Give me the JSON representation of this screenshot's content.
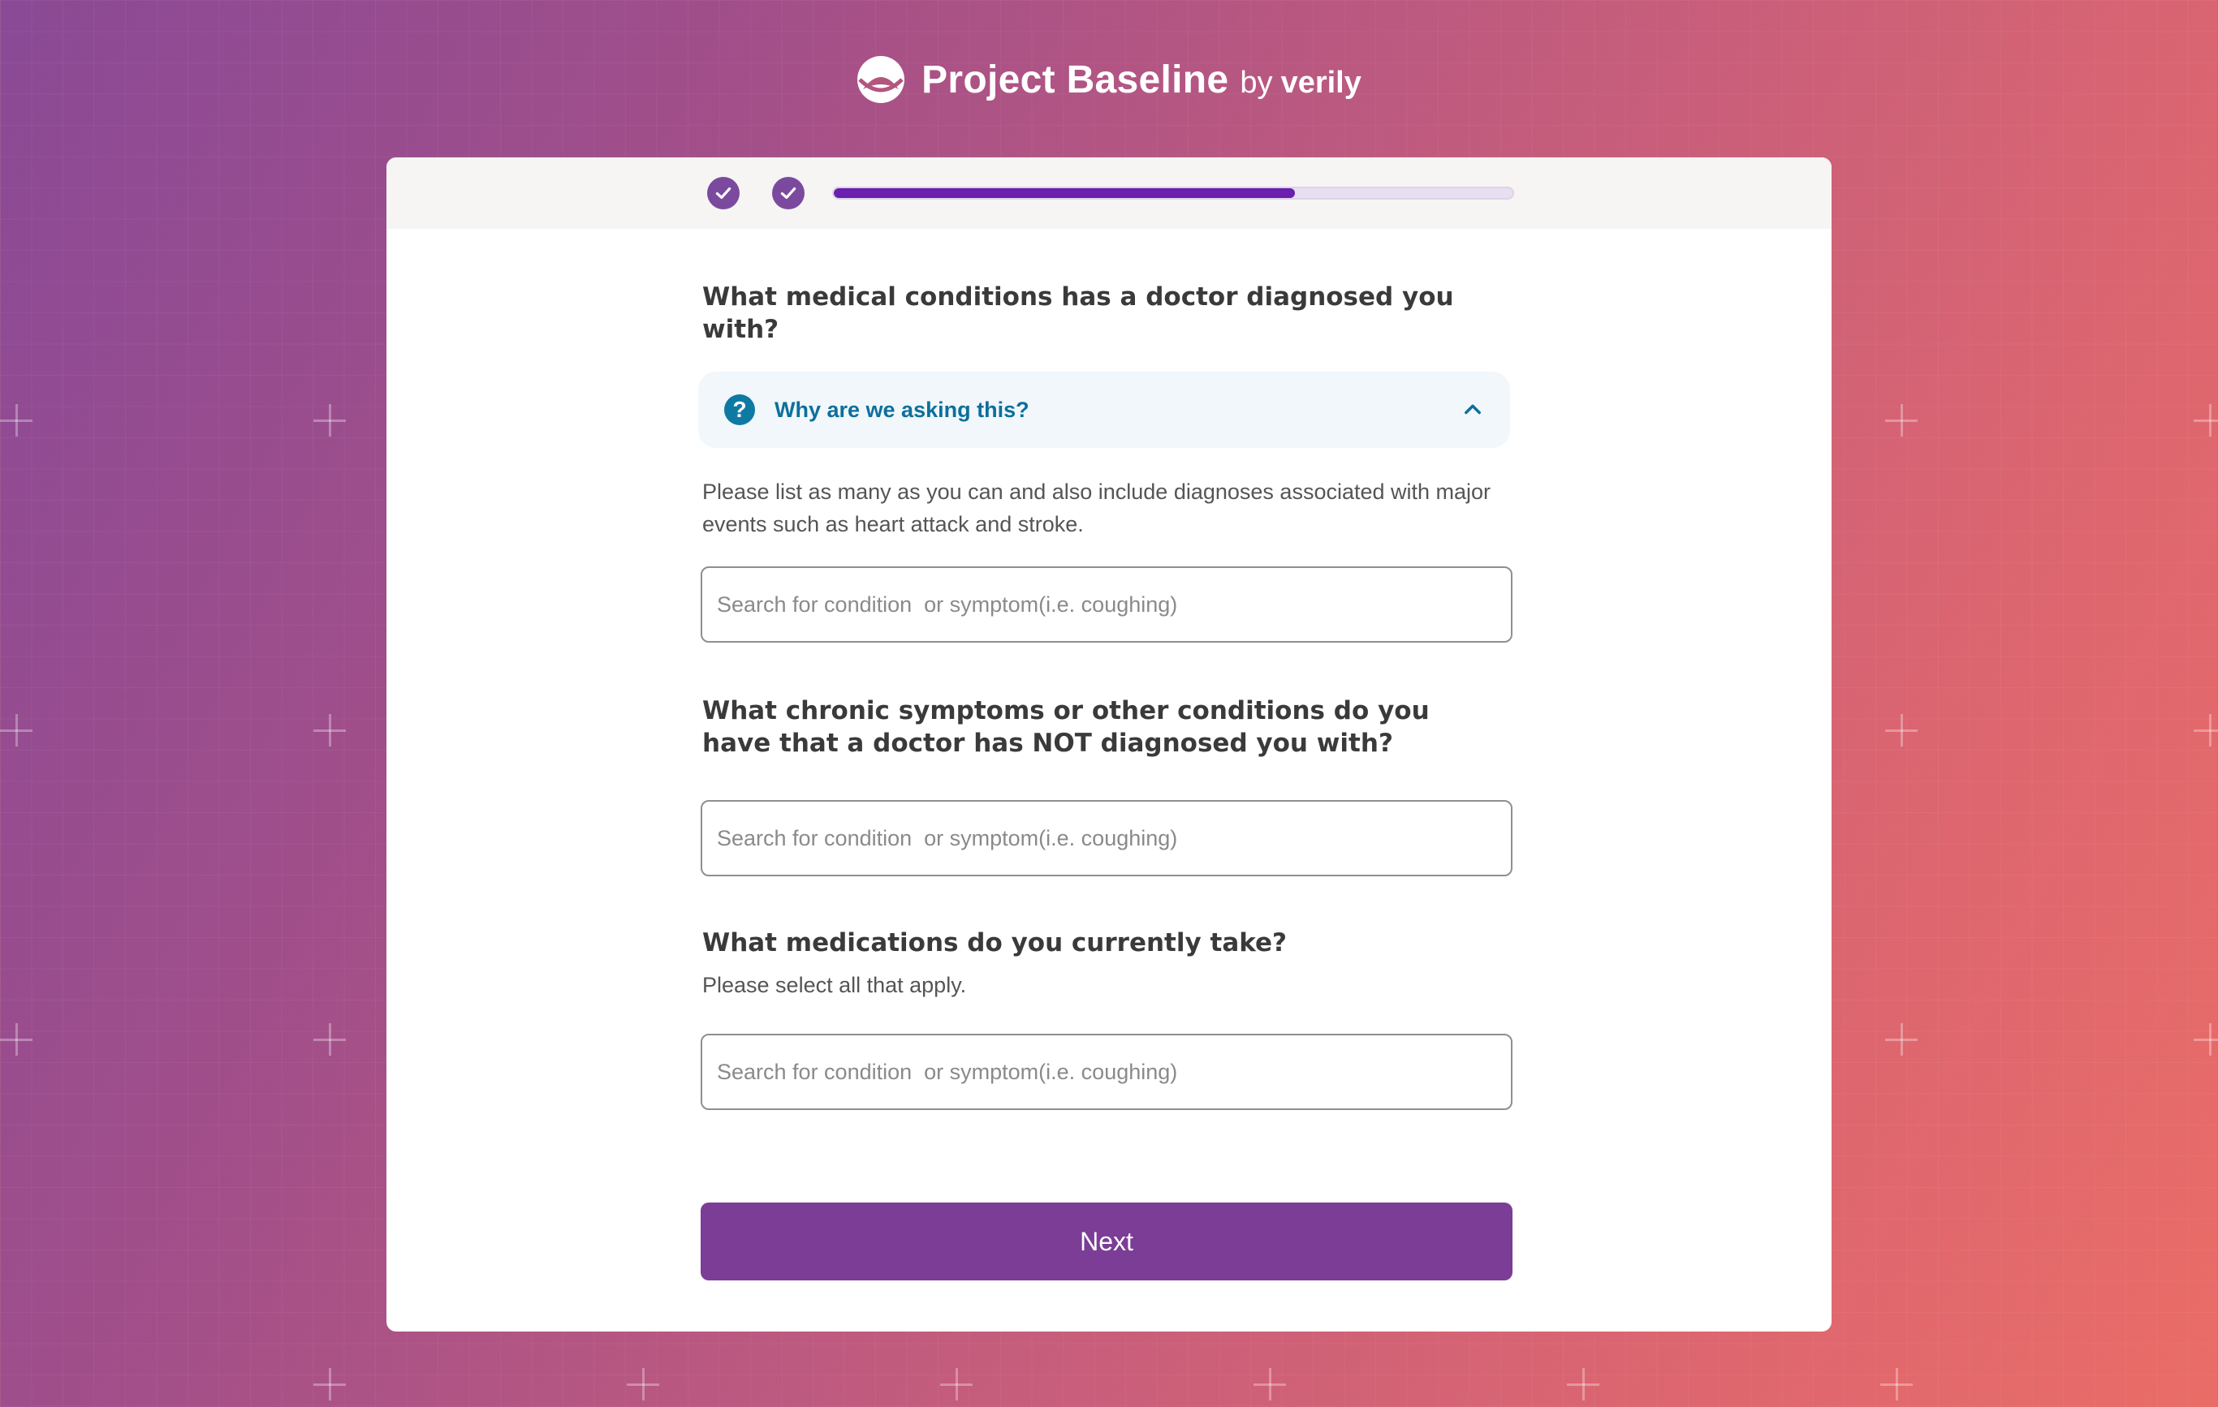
{
  "brand": {
    "name": "Project Baseline",
    "by": "by",
    "company": "verily"
  },
  "progress": {
    "completed_steps": 2,
    "current_step_fraction": 0.68
  },
  "questions": [
    {
      "title": "What medical conditions has a doctor diagnosed you with?",
      "help_label": "Why are we asking this?",
      "description": "Please list as many as you can and also include diagnoses associated with major events such as heart attack and stroke.",
      "placeholder": "Search for condition  or symptom(i.e. coughing)"
    },
    {
      "title": "What chronic symptoms or other conditions do you have that a doctor has NOT diagnosed you with?",
      "placeholder": "Search for condition  or symptom(i.e. coughing)"
    },
    {
      "title": "What medications do you currently take?",
      "description": "Please select all that apply.",
      "placeholder": "Search for condition  or symptom(i.e. coughing)"
    }
  ],
  "next_label": "Next",
  "colors": {
    "accent": "#7b3d96",
    "progress_fill": "#6a1fae",
    "help_text": "#0d6f9c"
  },
  "icons": [
    "logo-icon",
    "check-icon",
    "help-icon",
    "chevron-up-icon"
  ]
}
